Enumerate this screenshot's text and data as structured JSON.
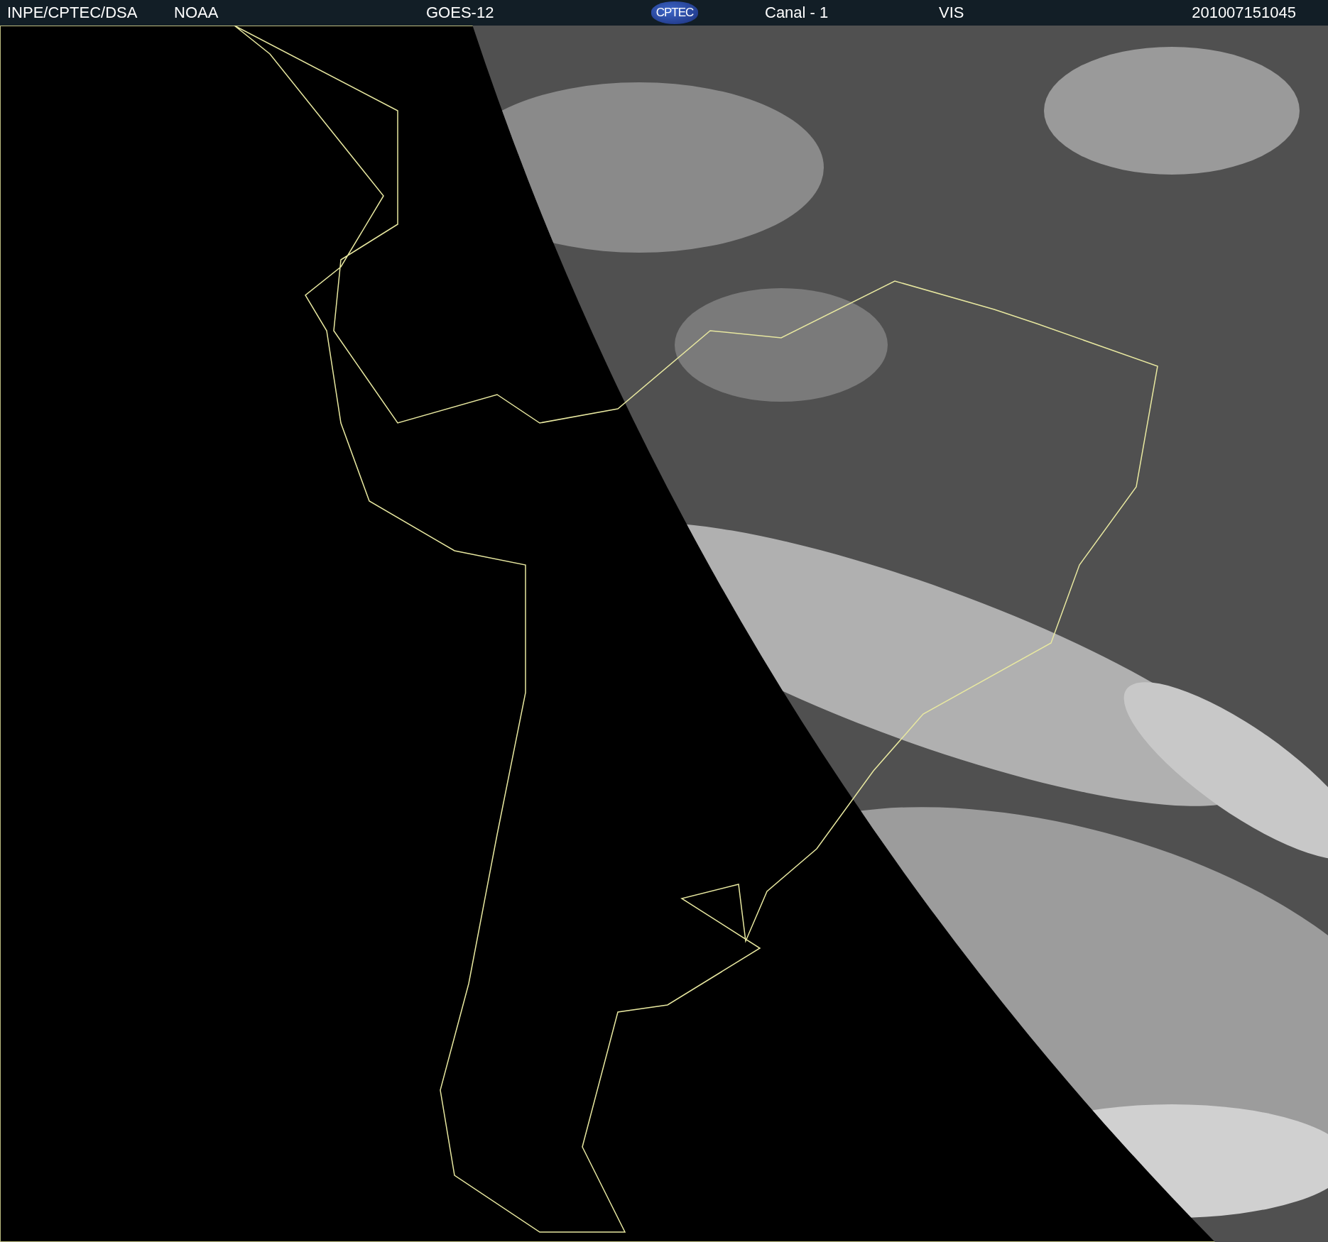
{
  "header": {
    "institution": "INPE/CPTEC/DSA",
    "agency": "NOAA",
    "satellite": "GOES-12",
    "logo_text": "CPTEC",
    "channel": "Canal - 1",
    "band": "VIS",
    "timestamp": "201007151045"
  }
}
